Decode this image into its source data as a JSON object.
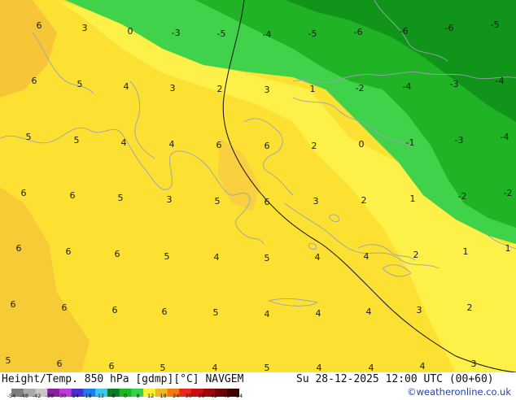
{
  "map": {
    "contour_labels": [
      [
        "6",
        48,
        35
      ],
      [
        "3",
        104,
        38
      ],
      [
        "0",
        160,
        42
      ],
      [
        "-3",
        216,
        44
      ],
      [
        "-5",
        272,
        45
      ],
      [
        "-4",
        328,
        46
      ],
      [
        "-5",
        384,
        45
      ],
      [
        "-6",
        440,
        43
      ],
      [
        "-6",
        496,
        42
      ],
      [
        "-6",
        552,
        38
      ],
      [
        "-5",
        608,
        34
      ],
      [
        "6",
        42,
        103
      ],
      [
        "5",
        98,
        107
      ],
      [
        "4",
        155,
        110
      ],
      [
        "3",
        212,
        112
      ],
      [
        "2",
        270,
        113
      ],
      [
        "3",
        328,
        114
      ],
      [
        "1",
        384,
        113
      ],
      [
        "-2",
        442,
        112
      ],
      [
        "-4",
        500,
        110
      ],
      [
        "-3",
        558,
        107
      ],
      [
        "-4",
        614,
        103
      ],
      [
        "5",
        35,
        172
      ],
      [
        "5",
        94,
        176
      ],
      [
        "4",
        152,
        179
      ],
      [
        "4",
        211,
        181
      ],
      [
        "6",
        269,
        182
      ],
      [
        "6",
        328,
        183
      ],
      [
        "2",
        386,
        183
      ],
      [
        "0",
        444,
        181
      ],
      [
        "-1",
        504,
        179
      ],
      [
        "-3",
        564,
        176
      ],
      [
        "-4",
        620,
        172
      ],
      [
        "6",
        29,
        241
      ],
      [
        "6",
        89,
        244
      ],
      [
        "5",
        148,
        247
      ],
      [
        "3",
        208,
        249
      ],
      [
        "5",
        267,
        251
      ],
      [
        "6",
        328,
        252
      ],
      [
        "3",
        388,
        251
      ],
      [
        "2",
        447,
        250
      ],
      [
        "1",
        507,
        248
      ],
      [
        "-2",
        568,
        245
      ],
      [
        "-2",
        627,
        241
      ],
      [
        "6",
        23,
        309
      ],
      [
        "6",
        84,
        313
      ],
      [
        "6",
        144,
        316
      ],
      [
        "5",
        205,
        319
      ],
      [
        "4",
        266,
        320
      ],
      [
        "5",
        328,
        321
      ],
      [
        "4",
        390,
        320
      ],
      [
        "4",
        450,
        319
      ],
      [
        "2",
        511,
        317
      ],
      [
        "1",
        572,
        313
      ],
      [
        "1",
        632,
        309
      ],
      [
        "6",
        16,
        378
      ],
      [
        "6",
        79,
        382
      ],
      [
        "6",
        141,
        385
      ],
      [
        "6",
        202,
        387
      ],
      [
        "5",
        265,
        388
      ],
      [
        "4",
        328,
        390
      ],
      [
        "4",
        391,
        389
      ],
      [
        "4",
        453,
        387
      ],
      [
        "3",
        515,
        385
      ],
      [
        "2",
        577,
        382
      ],
      [
        "5",
        10,
        447
      ],
      [
        "6",
        73,
        451
      ],
      [
        "6",
        137,
        454
      ],
      [
        "5",
        200,
        456
      ],
      [
        "4",
        264,
        457
      ],
      [
        "5",
        328,
        458
      ],
      [
        "4",
        392,
        458
      ],
      [
        "4",
        456,
        456
      ],
      [
        "4",
        519,
        454
      ],
      [
        "3",
        582,
        451
      ]
    ]
  },
  "footer": {
    "title": "Height/Temp. 850 hPa [gdmp][°C] NAVGEM",
    "valid_time": "Su 28-12-2025 12:00 UTC (00+60)",
    "credit": "©weatheronline.co.uk"
  },
  "colorbar": {
    "ticks": [
      "-54",
      "-48",
      "-42",
      "-38",
      "-30",
      "-24",
      "-18",
      "-12",
      "-8",
      "0",
      "8",
      "12",
      "18",
      "24",
      "30",
      "36",
      "42",
      "48",
      "54"
    ],
    "colors": [
      "#7d7d7d",
      "#a9a9a9",
      "#c8c8c8",
      "#8a1fa0",
      "#c238d8",
      "#4a2fd0",
      "#1c7cf0",
      "#38c8f0",
      "#0b7b28",
      "#18b820",
      "#34d34a",
      "#f8f030",
      "#f0b820",
      "#f07a10",
      "#e82818",
      "#c81010",
      "#a00808",
      "#6c0404",
      "#3c0202"
    ]
  }
}
